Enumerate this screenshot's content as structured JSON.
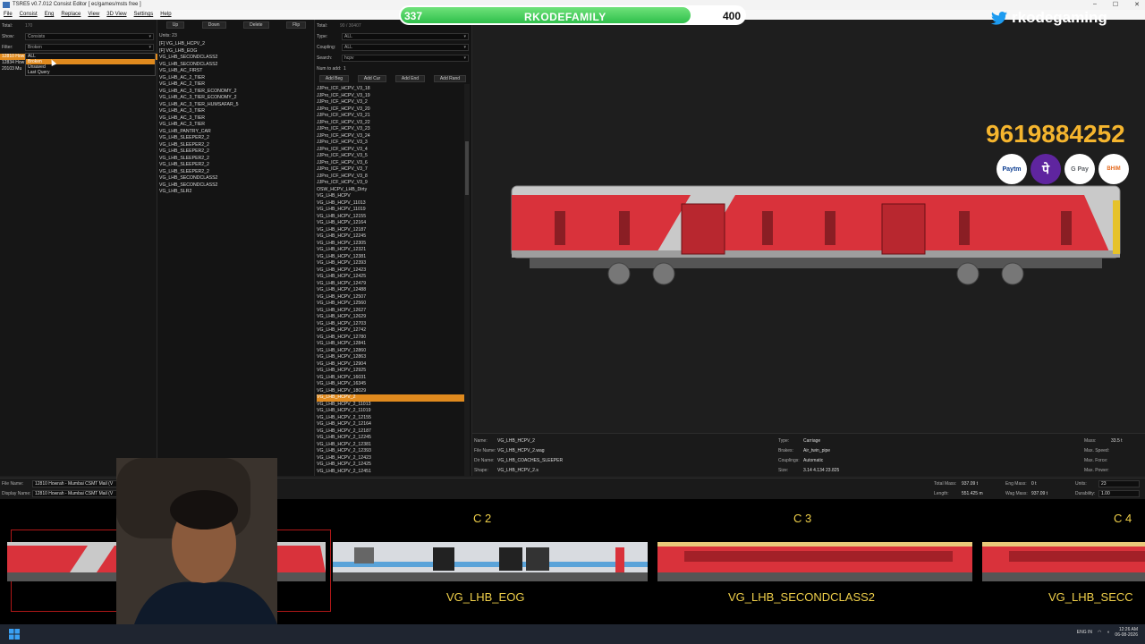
{
  "window": {
    "title": "TSRE5 v0.7.012 Consist Editor [ ec/games/msts free ]",
    "controls": [
      "–",
      "☐",
      "✕"
    ]
  },
  "menu": [
    "File",
    "Consist",
    "Eng",
    "Replace",
    "View",
    "3D View",
    "Settings",
    "Help"
  ],
  "left": {
    "total_label": "Total:",
    "total_value": "170",
    "show_label": "Show:",
    "show_value": "Consists",
    "filter_label": "Filter:",
    "filter_value": "Broken",
    "consists": [
      "12810 How",
      "12834 How",
      "20103 Mu"
    ],
    "popup_items": [
      "ALL",
      "Broken",
      "Unsaved",
      "Last Query"
    ],
    "popup_selected": 1
  },
  "units": {
    "buttons": [
      "Up",
      "Down",
      "Delete",
      "Flip"
    ],
    "count_label": "Units: 23",
    "items": [
      "[F] VG_LHB_HCPV_2",
      "[F] VG_LHB_EOG",
      "VG_LHB_SECONDCLASS2",
      "VG_LHB_SECONDCLASS2",
      "VG_LHB_AC_FIRST",
      "VG_LHB_AC_2_TIER",
      "VG_LHB_AC_2_TIER",
      "VG_LHB_AC_3_TIER_ECONOMY_2",
      "VG_LHB_AC_3_TIER_ECONOMY_2",
      "VG_LHB_AC_3_TIER_HUMSAFAR_5",
      "VG_LHB_AC_3_TIER",
      "VG_LHB_AC_3_TIER",
      "VG_LHB_AC_3_TIER",
      "VG_LHB_PANTRY_CAR",
      "VG_LHB_SLEEPER2_2",
      "VG_LHB_SLEEPER2_2",
      "VG_LHB_SLEEPER2_2",
      "VG_LHB_SLEEPER2_2",
      "VG_LHB_SLEEPER2_2",
      "VG_LHB_SLEEPER2_2",
      "VG_LHB_SECONDCLASS2",
      "VG_LHB_SECONDCLASS2",
      "VG_LHB_SLR2"
    ]
  },
  "catalog": {
    "total_label": "Total:",
    "total_value": "90 / 30407",
    "type_label": "Type:",
    "type_value": "ALL",
    "coupling_label": "Coupling:",
    "coupling_value": "ALL",
    "search_label": "Search:",
    "search_value": "hcpv",
    "num_label": "Num to add:",
    "num_value": "1",
    "buttons": [
      "Add Beg",
      "Add Cur",
      "Add End",
      "Add Rand"
    ],
    "items": [
      "JJPro_ICF_HCPV_V3_18",
      "JJPro_ICF_HCPV_V3_19",
      "JJPro_ICF_HCPV_V3_2",
      "JJPro_ICF_HCPV_V3_20",
      "JJPro_ICF_HCPV_V3_21",
      "JJPro_ICF_HCPV_V3_22",
      "JJPro_ICF_HCPV_V3_23",
      "JJPro_ICF_HCPV_V3_24",
      "JJPro_ICF_HCPV_V3_3",
      "JJPro_ICF_HCPV_V3_4",
      "JJPro_ICF_HCPV_V3_5",
      "JJPro_ICF_HCPV_V3_6",
      "JJPro_ICF_HCPV_V3_7",
      "JJPro_ICF_HCPV_V3_8",
      "JJPro_ICF_HCPV_V3_9",
      "OSW_HCPV_LHB_Dirty",
      "VG_LHB_HCPV",
      "VG_LHB_HCPV_11013",
      "VG_LHB_HCPV_11019",
      "VG_LHB_HCPV_12155",
      "VG_LHB_HCPV_12164",
      "VG_LHB_HCPV_12187",
      "VG_LHB_HCPV_12245",
      "VG_LHB_HCPV_12305",
      "VG_LHB_HCPV_12321",
      "VG_LHB_HCPV_12381",
      "VG_LHB_HCPV_12393",
      "VG_LHB_HCPV_12423",
      "VG_LHB_HCPV_12425",
      "VG_LHB_HCPV_12479",
      "VG_LHB_HCPV_12488",
      "VG_LHB_HCPV_12507",
      "VG_LHB_HCPV_12560",
      "VG_LHB_HCPV_12627",
      "VG_LHB_HCPV_12629",
      "VG_LHB_HCPV_12703",
      "VG_LHB_HCPV_12742",
      "VG_LHB_HCPV_12780",
      "VG_LHB_HCPV_12841",
      "VG_LHB_HCPV_12860",
      "VG_LHB_HCPV_12863",
      "VG_LHB_HCPV_12904",
      "VG_LHB_HCPV_12925",
      "VG_LHB_HCPV_16031",
      "VG_LHB_HCPV_16345",
      "VG_LHB_HCPV_18029",
      "VG_LHB_HCPV_2",
      "VG_LHB_HCPV_2_11013",
      "VG_LHB_HCPV_2_11019",
      "VG_LHB_HCPV_2_12155",
      "VG_LHB_HCPV_2_12164",
      "VG_LHB_HCPV_2_12187",
      "VG_LHB_HCPV_2_12245",
      "VG_LHB_HCPV_2_12381",
      "VG_LHB_HCPV_2_12393",
      "VG_LHB_HCPV_2_12423",
      "VG_LHB_HCPV_2_12425",
      "VG_LHB_HCPV_2_12451"
    ],
    "selected": 46
  },
  "info": {
    "name_label": "Name:",
    "name_value": "VG_LHB_HCPV_2",
    "file_label": "File Name:",
    "file_value": "VG_LHB_HCPV_2.wag",
    "dir_label": "Dir Name:",
    "dir_value": "VG_LHB_COACHES_SLEEPER",
    "shape_label": "Shape:",
    "shape_value": "VG_LHB_HCPV_2.s",
    "type_label": "Type:",
    "type_value": "Carriage",
    "brakes_label": "Brakes:",
    "brakes_value": "Air_twin_pipe",
    "couplings_label": "Couplings:",
    "couplings_value": "Automatic",
    "size_label": "Size:",
    "size_value": "3.14 4.134 23.825",
    "mass_label": "Mass:",
    "mass_value": "33.5 t",
    "maxspeed_label": "Max. Speed:",
    "maxforce_label": "Max. Force:",
    "maxpower_label": "Max. Power:"
  },
  "bottom": {
    "file_label": "File Name:",
    "file_value": "12810 Howrah - Mumbai CSMT Mail (V",
    "display_label": "Display Name:",
    "display_value": "12810 Howrah - Mumbai CSMT Mail (V",
    "totalmass_label": "Total Mass:",
    "totalmass_value": "937.09 t",
    "length_label": "Length:",
    "length_value": "551.425 m",
    "engmass_label": "Eng Mass:",
    "engmass_value": "0 t",
    "wagmass_label": "Wag Mass:",
    "wagmass_value": "937.09 t",
    "units_label": "Units:",
    "units_value": "23",
    "durability_label": "Durability:",
    "durability_value": "1.00"
  },
  "strip": {
    "positions": [
      "C 2",
      "C 3",
      "C 4"
    ],
    "names": [
      "VG_LHB_EOG",
      "VG_LHB_SECONDCLASS2",
      "VG_LHB_SECC"
    ]
  },
  "overlay": {
    "bar_left": "337",
    "bar_name": "RKODEFAMILY",
    "bar_right": "400",
    "bar_fraction": 0.8425,
    "twitter_handle": "rkodegaming",
    "phone": "9619884252",
    "pay": [
      "Paytm",
      "पे",
      "G Pay",
      "BHIM"
    ]
  },
  "taskbar": {
    "lang": "ENG IN",
    "time": "12:26 AM",
    "date": "06-08-2026"
  },
  "colors": {
    "selection": "#e08a1e",
    "accent_text": "#f0d04a",
    "coach_red": "#d9323b"
  }
}
